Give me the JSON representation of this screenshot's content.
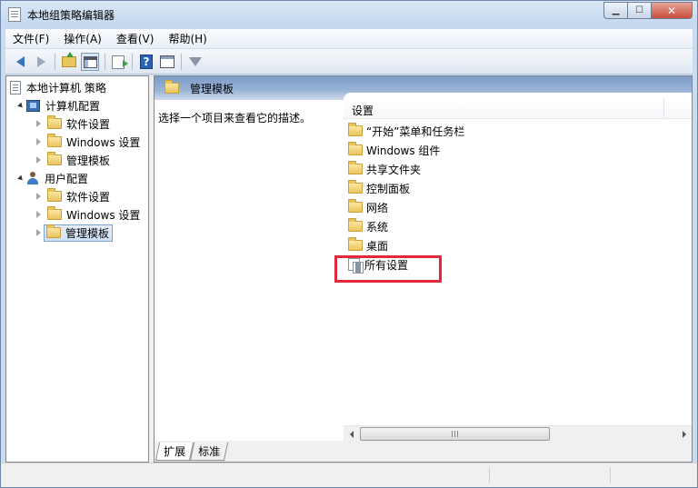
{
  "window": {
    "title": "本地组策略编辑器"
  },
  "menu": [
    "文件(F)",
    "操作(A)",
    "查看(V)",
    "帮助(H)"
  ],
  "toolbar_icons": [
    "back-icon",
    "forward-icon",
    "up-folder-icon",
    "show-hide-tree-icon",
    "export-list-icon",
    "help-icon",
    "properties-icon",
    "filter-icon"
  ],
  "tree": {
    "root": "本地计算机 策略",
    "computer": "计算机配置",
    "computer_children": [
      "软件设置",
      "Windows 设置",
      "管理模板"
    ],
    "user": "用户配置",
    "user_children": [
      "软件设置",
      "Windows 设置",
      "管理模板"
    ]
  },
  "right": {
    "header": "管理模板",
    "description": "选择一个项目来查看它的描述。",
    "column_header": "设置",
    "items": [
      "“开始”菜单和任务栏",
      "Windows 组件",
      "共享文件夹",
      "控制面板",
      "网络",
      "系统",
      "桌面"
    ],
    "all_settings": "所有设置"
  },
  "tabs": [
    "扩展",
    "标准"
  ],
  "colors": {
    "highlight_border": "#e3283b",
    "header_blue": "#7b9bc6",
    "selection": "#cfe0f5"
  }
}
